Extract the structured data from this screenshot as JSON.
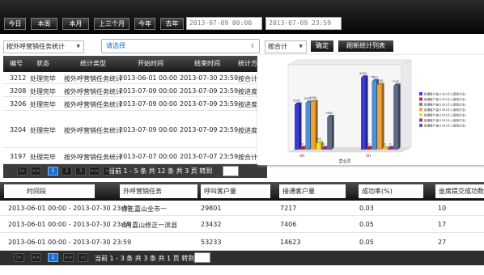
{
  "toolbar": {
    "quick_ranges": [
      "今日",
      "本周",
      "本月",
      "上三个月",
      "今年",
      "去年"
    ],
    "start_date": "2013-07-09 00:00",
    "end_date": "2013-07-09 23:59"
  },
  "filters": {
    "task_type_select": "按外呼营销任务统计",
    "task_select_placeholder": "请选择",
    "aggregate_select": "按合计",
    "confirm_label": "确定",
    "refresh_label": "刷新统计列表"
  },
  "stats_table": {
    "columns": [
      "编号",
      "状态",
      "统计类型",
      "开始时间",
      "结束时间",
      "统计方式"
    ],
    "rows": [
      {
        "id": "3212",
        "status": "处理完毕",
        "type": "按外呼营销任务统计",
        "start": "2013-06-01 00:00",
        "end": "2013-07-30 23:59",
        "mode": "按合计"
      },
      {
        "id": "3208",
        "status": "处理完毕",
        "type": "按外呼营销任务统计",
        "start": "2013-07-09 00:00",
        "end": "2013-07-09 23:59",
        "mode": "按进度"
      },
      {
        "id": "3206",
        "status": "处理完毕",
        "type": "按外呼营销任务统计",
        "start": "2013-07-09 00:00",
        "end": "2013-07-09 23:59",
        "mode": "按进度"
      },
      {
        "id": "3204",
        "status": "处理完毕",
        "type": "按外呼营销任务统计",
        "start": "2013-07-09 00:00",
        "end": "2013-07-09 23:59",
        "mode": "按进度"
      },
      {
        "id": "3197",
        "status": "处理完毕",
        "type": "按外呼营销任务统计",
        "start": "2013-07-07 00:00",
        "end": "2013-07-07 23:59",
        "mode": "按合计"
      }
    ],
    "pager": {
      "buttons": [
        "|<",
        "<<",
        "1",
        "2",
        "3",
        ">>",
        ">|"
      ],
      "current": "1",
      "summary": "当前 1 - 5 条 共 12 条 共 3 页 转到"
    }
  },
  "result_table": {
    "columns": [
      "时间段",
      "外呼营销任务",
      "呼叫客户量",
      "接通客户量",
      "成功率(%)",
      "坐席提交成功数"
    ],
    "rows": [
      {
        "period": "2013-06-01 00:00 - 2013-07-30 23:59",
        "task": "修正嘉山全市一",
        "calls": "29801",
        "connected": "7217",
        "rate": "0.03",
        "success": "10"
      },
      {
        "period": "2013-06-01 00:00 - 2013-07-30 23:59",
        "task": "6月嘉山修正一滨县",
        "calls": "23432",
        "connected": "7406",
        "rate": "0.05",
        "success": "17"
      },
      {
        "period": "2013-06-01 00:00 - 2013-07-30 23:59",
        "task": "",
        "calls": "53233",
        "connected": "14623",
        "rate": "0.05",
        "success": "27"
      }
    ],
    "pager": {
      "buttons": [
        "|<",
        "<<",
        "1",
        ">>",
        ">|"
      ],
      "current": "1",
      "summary": "当前 1 - 3 条 共 3 条 共 1 页 转到"
    }
  },
  "chart_data": {
    "type": "bar",
    "categories": [
      "3H",
      "5H"
    ],
    "series": [
      {
        "name": "接通客户量(1301计入营销方法)",
        "color": "#3b3bd9",
        "values": [
          5000,
          8000
        ]
      },
      {
        "name": "接通客户量(1301计入营销方法)",
        "color": "#d81f3a",
        "values": [
          0,
          0
        ]
      },
      {
        "name": "接通客户量(1301计入营销方法)",
        "color": "#4e8fd2",
        "values": [
          5200,
          7600
        ]
      },
      {
        "name": "接通客户量(1301计入营销方法)",
        "color": "#f2a12f",
        "values": [
          5300,
          7200
        ]
      },
      {
        "name": "接通客户量(1301计入营销方法)",
        "color": "#f0e02a",
        "values": [
          700,
          0
        ]
      },
      {
        "name": "接通客户量(1301计入营销方法)",
        "color": "#a12fb0",
        "values": [
          0,
          0
        ]
      },
      {
        "name": "接通客户量(1301计入营销方法)",
        "color": "#5f6a86",
        "values": [
          3600,
          7100
        ]
      }
    ],
    "data_labels": [
      "5000",
      "0",
      "5200",
      "5300",
      "700",
      "0",
      "3600",
      "8000",
      "0",
      "7600",
      "7200",
      "0",
      "0",
      "7100"
    ],
    "xlabel": "营业员",
    "ylim": [
      0,
      9000
    ],
    "grid": false,
    "legend": "right",
    "style": "3d"
  }
}
